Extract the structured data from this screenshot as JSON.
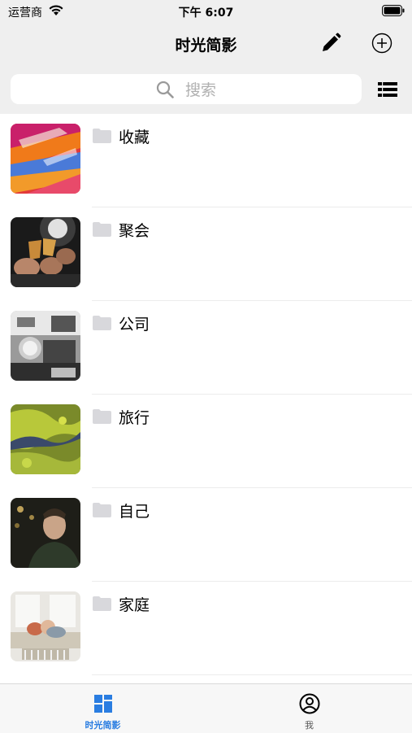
{
  "status_bar": {
    "carrier": "运营商",
    "time": "下午 6:07"
  },
  "nav": {
    "title": "时光简影",
    "edit_icon": "pencil-icon",
    "add_icon": "plus-circle-icon"
  },
  "search": {
    "placeholder": "搜索",
    "list_view_icon": "list-view-icon"
  },
  "albums": [
    {
      "label": "收藏"
    },
    {
      "label": "聚会"
    },
    {
      "label": "公司"
    },
    {
      "label": "旅行"
    },
    {
      "label": "自己"
    },
    {
      "label": "家庭"
    }
  ],
  "tabs": [
    {
      "label": "时光简影",
      "icon": "grid-icon",
      "active": true
    },
    {
      "label": "我",
      "icon": "user-circle-icon",
      "active": false
    }
  ],
  "colors": {
    "accent": "#2a7de1",
    "folder": "#d8d8dc",
    "bar_bg": "#efefef"
  }
}
